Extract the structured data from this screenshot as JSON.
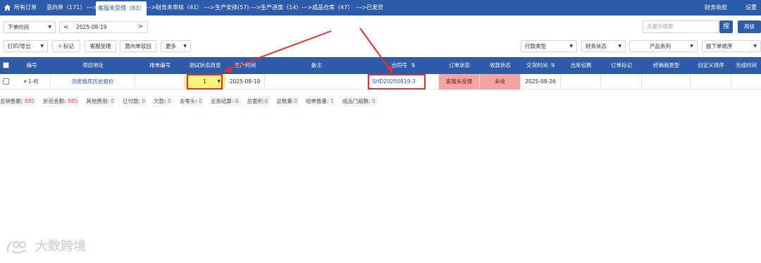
{
  "nav": {
    "items": [
      {
        "label": "所有订单"
      },
      {
        "label": "意向单（171）"
      },
      {
        "label": "客服未受理（83）"
      },
      {
        "label": "财务未审核（41）"
      },
      {
        "label": "生产安排(57)"
      },
      {
        "label": "生产进度（14）"
      },
      {
        "label": "成品仓库（47）"
      },
      {
        "label": "已发货"
      }
    ],
    "arrow": "--->",
    "finance": "财务收款",
    "settings": "设置"
  },
  "filters": {
    "time_type": "下单时间",
    "date": "2025-08-19",
    "prev": "<",
    "next": ">",
    "search_placeholder": "关键字搜索",
    "search_button": "搜",
    "advanced_button": "高级"
  },
  "toolbar": {
    "print_export": "打印/导出",
    "mark": "标记",
    "cs_accept": "客服受理",
    "intent_return": "意向单驳回",
    "more": "更多",
    "payment_type": "付款类型",
    "finance_status": "财务状态",
    "product_series": "产品系列",
    "sort": "按下单顺序"
  },
  "table": {
    "headers": {
      "number": "编号",
      "project": "项目地址",
      "order_no": "排单编号",
      "test_status": "测试状态改变",
      "production_time": "生产时间",
      "remark": "备注",
      "contract": "合同号",
      "order_status": "订单状态",
      "receipt_status": "收款状态",
      "delivery_time": "交货时间",
      "outbound": "出库包数",
      "order_mark": "订单标记",
      "dealer_type": "经销商类型",
      "custom_sort": "自定义排序",
      "finish_time": "完成时间"
    },
    "row": {
      "number": "▾ 1-柜",
      "project": "测老板房历史报价",
      "order_no": "",
      "test_status": "1",
      "production_time": "2025-08-19",
      "remark": "",
      "contract": "SHD20250819-3",
      "order_status": "客服未受理",
      "receipt_status": "未收",
      "delivery_time": "2025-08-26",
      "outbound": "",
      "order_mark": "",
      "dealer_type": "",
      "custom_sort": "",
      "finish_time": ""
    }
  },
  "summary": {
    "total_sales_label": "总销售额:",
    "total_sales": "885",
    "discount_label": "折后金额:",
    "discount": "885",
    "other_fee_label": "其他费用:",
    "other_fee": "0",
    "paid_label": "已付款:",
    "paid": "0",
    "owed_label": "欠款:",
    "owed": "0",
    "rounding_label": "去零头:",
    "rounding": "0",
    "settlement_label": "业务结算:",
    "settlement": "0",
    "area_label": "总面积:",
    "area": "0",
    "qty_label": "总数量:",
    "qty": "0",
    "group_label": "组单数量:",
    "group": "1",
    "doors_label": "成品门扇数:",
    "doors": "0"
  },
  "watermark": "大数跨境",
  "colors": {
    "primary": "#2f5caa",
    "annotation": "#e03030",
    "status_pink": "#f5a3a3",
    "highlight": "#fff27a"
  }
}
